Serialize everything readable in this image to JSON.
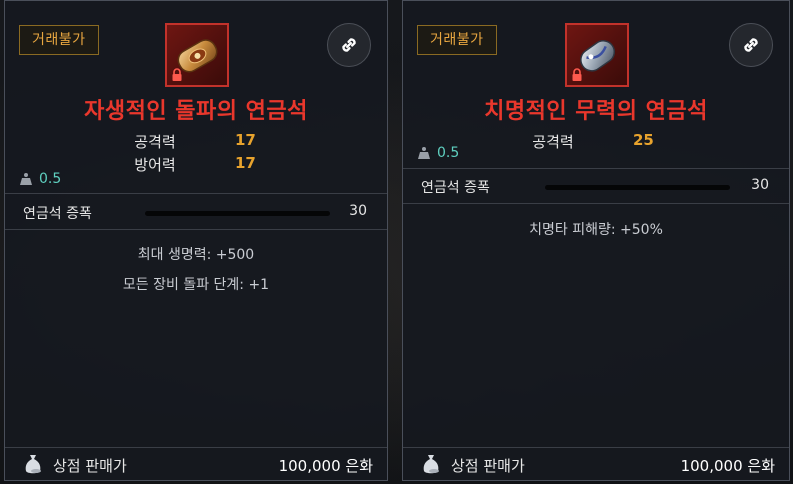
{
  "cards": [
    {
      "trade_badge": "거래불가",
      "item_name": "자생적인 돌파의 연금석",
      "stats": [
        {
          "label": "공격력",
          "value": "17"
        },
        {
          "label": "방어력",
          "value": "17"
        }
      ],
      "weight": "0.5",
      "amplification": {
        "label": "연금석 증폭",
        "value": "30"
      },
      "effects": [
        "최대 생명력: +500",
        "모든 장비 돌파 단계: +1"
      ],
      "sell": {
        "label": "상점 판매가",
        "price": "100,000 은화"
      },
      "icon": "bronze-alchemy-stone-icon"
    },
    {
      "trade_badge": "거래불가",
      "item_name": "치명적인 무력의 연금석",
      "stats": [
        {
          "label": "공격력",
          "value": "25"
        }
      ],
      "weight": "0.5",
      "amplification": {
        "label": "연금석 증폭",
        "value": "30"
      },
      "effects": [
        "치명타 피해량: +50%"
      ],
      "sell": {
        "label": "상점 판매가",
        "price": "100,000 은화"
      },
      "icon": "silver-alchemy-stone-icon"
    }
  ],
  "colors": {
    "item_name": "#e9372c",
    "stat_value": "#e8a32d",
    "badge_text": "#e8a640",
    "weight_text": "#5fd0c0"
  }
}
